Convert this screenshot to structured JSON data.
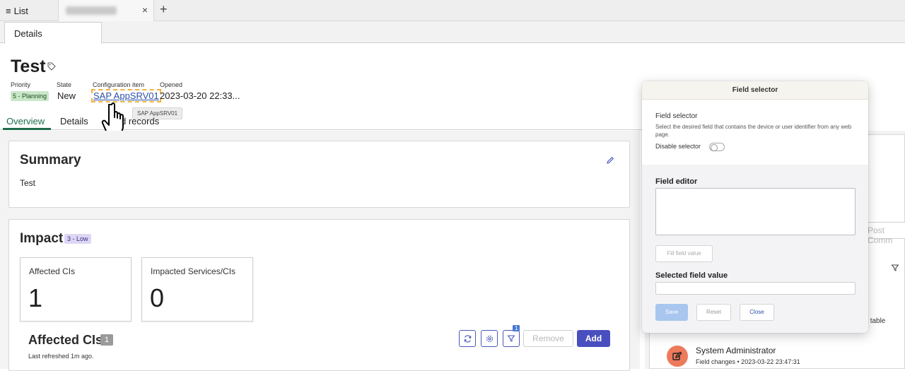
{
  "top_tabs": {
    "list_label": "List",
    "list_icon": "hamburger-icon",
    "record_tab_close": "×",
    "new_tab": "+"
  },
  "sub_tab": {
    "details": "Details"
  },
  "record": {
    "title": "Test",
    "meta": {
      "priority_label": "Priority",
      "priority_value": "5 - Planning",
      "state_label": "State",
      "state_value": "New",
      "ci_label": "Configuration item",
      "ci_value": "SAP AppSRV01",
      "opened_label": "Opened",
      "opened_value": "2023-03-20 22:33..."
    },
    "tooltip": "SAP AppSRV01"
  },
  "inner_tabs": {
    "overview": "Overview",
    "details": "Details",
    "related": "d records"
  },
  "summary": {
    "title": "Summary",
    "text": "Test"
  },
  "impact": {
    "title": "Impact",
    "badge": "3 - Low",
    "affected_cis_label": "Affected CIs",
    "affected_cis_value": "1",
    "impacted_services_label": "Impacted Services/CIs",
    "impacted_services_value": "0"
  },
  "affected_cis": {
    "title": "Affected CIs",
    "count": "1",
    "refreshed": "Last refreshed 1m ago.",
    "filter_count": "1",
    "remove_label": "Remove",
    "add_label": "Add"
  },
  "right_panel": {
    "post_comment": "Post Comm",
    "table_text": "' table",
    "activity_name": "System Administrator",
    "activity_meta": "Field changes • 2023-03-22 23:47:31"
  },
  "field_selector": {
    "header": "Field selector",
    "section_title": "Field selector",
    "description": "Select the desired field that contains the device or user identifier from any web page.",
    "disable_label": "Disable selector",
    "editor_title": "Field editor",
    "fill_button": "Fill field value",
    "selected_title": "Selected field value",
    "save": "Save",
    "reset": "Reset",
    "close": "Close"
  },
  "colors": {
    "accent_green": "#1e6b4b",
    "brand_purple": "#4a4fbf",
    "avatar_orange": "#ee7a5c",
    "ci_highlight": "#f0b33a"
  }
}
